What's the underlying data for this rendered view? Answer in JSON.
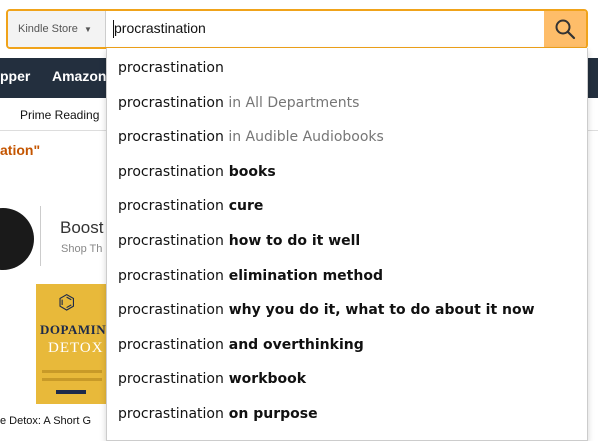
{
  "background": {
    "nav_left": "pper",
    "nav_right": "Amazon",
    "subnav_item": "Prime Reading",
    "result_title": "ation\"",
    "sponsor_title": "Boost",
    "sponsor_link": "Shop Th",
    "book_title_1": "DOPAMIN",
    "book_title_2": "DETOX",
    "book_caption": "e Detox: A Short G"
  },
  "search": {
    "department": "Kindle Store",
    "query": "procrastination",
    "button_icon": "search-icon",
    "accent_color": "#f0a31a",
    "button_color": "#febd69"
  },
  "suggestions": [
    {
      "base": "procrastination",
      "suffix": "",
      "style": "none"
    },
    {
      "base": "procrastination",
      "suffix": " in All Departments",
      "style": "dim"
    },
    {
      "base": "procrastination",
      "suffix": " in Audible Audiobooks",
      "style": "dim"
    },
    {
      "base": "procrastination",
      "suffix": " books",
      "style": "bold"
    },
    {
      "base": "procrastination",
      "suffix": " cure",
      "style": "bold"
    },
    {
      "base": "procrastination",
      "suffix": " how to do it well",
      "style": "bold"
    },
    {
      "base": "procrastination",
      "suffix": " elimination method",
      "style": "bold"
    },
    {
      "base": "procrastination",
      "suffix": " why you do it, what to do about it now",
      "style": "bold"
    },
    {
      "base": "procrastination",
      "suffix": " and overthinking",
      "style": "bold"
    },
    {
      "base": "procrastination",
      "suffix": " workbook",
      "style": "bold"
    },
    {
      "base": "procrastination",
      "suffix": " on purpose",
      "style": "bold"
    }
  ]
}
